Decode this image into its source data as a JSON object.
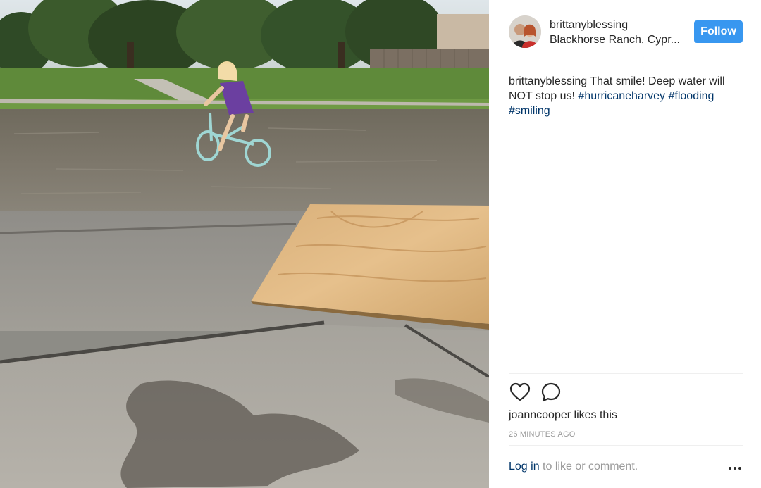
{
  "post": {
    "photo_alt": "Girl riding a bicycle through flood water",
    "author": {
      "username": "brittanyblessing",
      "location": "Blackhorse Ranch, Cypr...",
      "avatar_icon": "profile-photo"
    },
    "follow_label": "Follow",
    "caption": {
      "username": "brittanyblessing",
      "text": "That smile! Deep water will NOT stop us!",
      "hashtags": [
        "#hurricaneharvey",
        "#flooding",
        "#smiling"
      ]
    },
    "actions": {
      "like_icon": "heart-icon",
      "comment_icon": "comment-bubble-icon"
    },
    "likes": {
      "liker": "joanncooper",
      "suffix": "likes this"
    },
    "timestamp": "26 MINUTES AGO",
    "comment_prompt": {
      "login_label": "Log in",
      "rest": "to like or comment."
    },
    "more_icon": "more-options-icon"
  },
  "colors": {
    "follow_button": "#3897f0",
    "hashtag_link": "#003569",
    "muted_text": "#999999",
    "divider": "#efefef"
  }
}
